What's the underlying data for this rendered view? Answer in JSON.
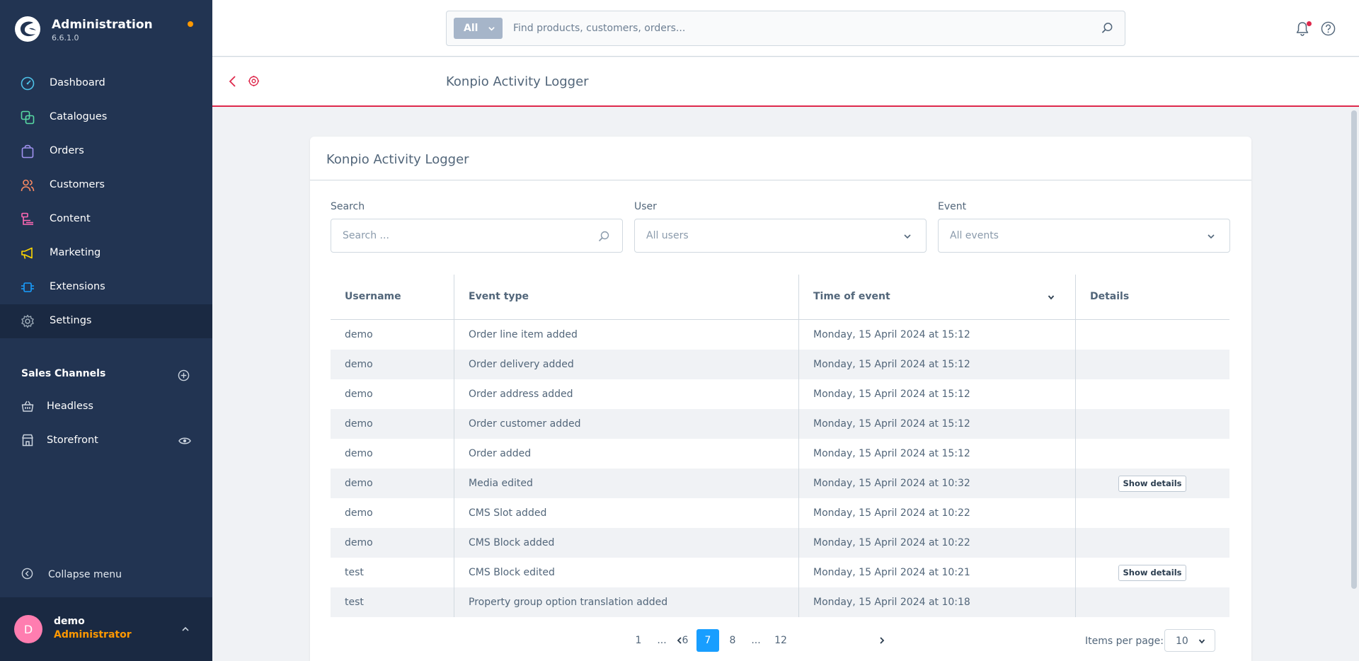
{
  "app": {
    "title": "Administration",
    "version": "6.6.1.0",
    "notification_dot_color": "#ff9800"
  },
  "nav": {
    "items": [
      {
        "label": "Dashboard",
        "icon": "dashboard-icon",
        "color": "#4ec2e8"
      },
      {
        "label": "Catalogues",
        "icon": "catalogue-icon",
        "color": "#57d9a3"
      },
      {
        "label": "Orders",
        "icon": "orders-bag-icon",
        "color": "#a092f0"
      },
      {
        "label": "Customers",
        "icon": "customers-icon",
        "color": "#f88962"
      },
      {
        "label": "Content",
        "icon": "content-icon",
        "color": "#ff68b4"
      },
      {
        "label": "Marketing",
        "icon": "megaphone-icon",
        "color": "#ffd700"
      },
      {
        "label": "Extensions",
        "icon": "plugin-icon",
        "color": "#189eff"
      },
      {
        "label": "Settings",
        "icon": "settings-gear-icon",
        "color": "#9aa8b5",
        "active": true
      }
    ]
  },
  "sales_channels": {
    "heading": "Sales Channels",
    "items": [
      {
        "label": "Headless",
        "icon": "basket-icon"
      },
      {
        "label": "Storefront",
        "icon": "storefront-icon"
      }
    ]
  },
  "collapse_label": "Collapse menu",
  "user": {
    "initial": "D",
    "name": "demo",
    "role": "Administrator",
    "avatar_color": "#ff7db0",
    "role_color": "#ff9800"
  },
  "global_search": {
    "scope": "All",
    "placeholder": "Find products, customers, orders..."
  },
  "page": {
    "title": "Konpio Activity Logger",
    "accent_color": "#de294c"
  },
  "card": {
    "title": "Konpio Activity Logger"
  },
  "filters": {
    "search_label": "Search",
    "search_placeholder": "Search ...",
    "user_label": "User",
    "user_value": "All users",
    "event_label": "Event",
    "event_value": "All events"
  },
  "table": {
    "columns": [
      "Username",
      "Event type",
      "Time of event",
      "Details"
    ],
    "rows": [
      {
        "username": "demo",
        "event": "Order line item added",
        "time": "Monday, 15 April 2024 at 15:12",
        "details": ""
      },
      {
        "username": "demo",
        "event": "Order delivery added",
        "time": "Monday, 15 April 2024 at 15:12",
        "details": ""
      },
      {
        "username": "demo",
        "event": "Order address added",
        "time": "Monday, 15 April 2024 at 15:12",
        "details": ""
      },
      {
        "username": "demo",
        "event": "Order customer added",
        "time": "Monday, 15 April 2024 at 15:12",
        "details": ""
      },
      {
        "username": "demo",
        "event": "Order added",
        "time": "Monday, 15 April 2024 at 15:12",
        "details": ""
      },
      {
        "username": "demo",
        "event": "Media edited",
        "time": "Monday, 15 April 2024 at 10:32",
        "details": "Show details"
      },
      {
        "username": "demo",
        "event": "CMS Slot added",
        "time": "Monday, 15 April 2024 at 10:22",
        "details": ""
      },
      {
        "username": "demo",
        "event": "CMS Block added",
        "time": "Monday, 15 April 2024 at 10:22",
        "details": ""
      },
      {
        "username": "test",
        "event": "CMS Block edited",
        "time": "Monday, 15 April 2024 at 10:21",
        "details": "Show details"
      },
      {
        "username": "test",
        "event": "Property group option translation added",
        "time": "Monday, 15 April 2024 at 10:18",
        "details": ""
      }
    ]
  },
  "pagination": {
    "pages": [
      "1",
      "...",
      "6",
      "7",
      "8",
      "...",
      "12"
    ],
    "current": "7",
    "items_per_page_label": "Items per page:",
    "items_per_page": "10",
    "active_color": "#189eff"
  }
}
